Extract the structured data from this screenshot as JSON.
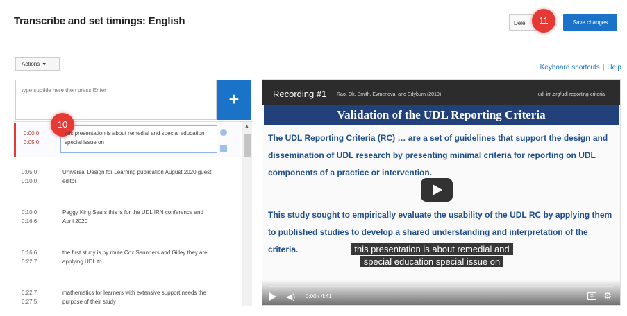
{
  "header": {
    "title": "Transcribe and set timings: English",
    "delete_label": "Dele",
    "save_label": "Save changes"
  },
  "markers": {
    "step11": "11",
    "step10": "10"
  },
  "toolbar": {
    "actions_label": "Actions",
    "keyboard_shortcuts": "Keyboard shortcuts",
    "separator": "|",
    "help": "Help"
  },
  "subtitle_input": {
    "placeholder": "type subtitle here then press Enter",
    "add_symbol": "+"
  },
  "captions": [
    {
      "start": "0:00.0",
      "end": "0:05.0",
      "text": "this presentation is about remedial and special education special issue on",
      "active": true
    },
    {
      "start": "0:05.0",
      "end": "0:10.0",
      "text": "Universal Design for Learning publication August 2020 guest editor",
      "active": false
    },
    {
      "start": "0:10.0",
      "end": "0:16.6",
      "text": "Peggy King Sears this is for the UDL IRN conference and April 2020",
      "active": false
    },
    {
      "start": "0:16.6",
      "end": "0:22.7",
      "text": "the first study is by route Cox Saunders and Gilley they are applying UDL to",
      "active": false
    },
    {
      "start": "0:22.7",
      "end": "0:27.5",
      "text": "mathematics for learners with extensive support needs the purpose of their study",
      "active": false
    }
  ],
  "video": {
    "recording_label": "Recording #1",
    "source": "Rao, Ok, Smith, Evmenova, and Edyburn (2019)",
    "url": "udl-irn.org/udl-reporting-criteria",
    "banner": "Validation of the UDL Reporting Criteria",
    "para1": "The UDL Reporting Criteria (RC) … are a set of guidelines that support the design and dissemination of UDL research by presenting minimal criteria for reporting on UDL components of a practice or intervention.",
    "para2": "This study sought to empirically evaluate the usability of the UDL RC by applying them to published studies to develop a shared understanding and interpretation of the criteria.",
    "caption_line1": "this presentation is about remedial and",
    "caption_line2": "special education special issue on",
    "time": "0:00 / 4:41",
    "cc_label": "CC"
  },
  "colors": {
    "accent": "#1a73c9",
    "marker": "#e53935",
    "banner": "#22407a",
    "slide_text": "#1f4e8c"
  }
}
